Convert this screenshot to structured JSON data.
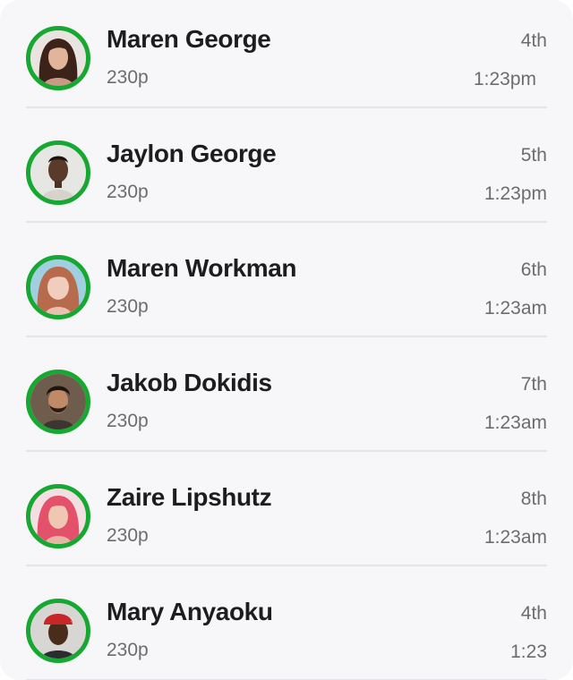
{
  "leaderboard": {
    "accent_color": "#17a832",
    "entries": [
      {
        "name": "Maren George",
        "points": "230p",
        "rank": "4th",
        "time": "1:23pm"
      },
      {
        "name": "Jaylon George",
        "points": "230p",
        "rank": "5th",
        "time": "1:23pm"
      },
      {
        "name": "Maren Workman",
        "points": "230p",
        "rank": "6th",
        "time": "1:23am"
      },
      {
        "name": "Jakob Dokidis",
        "points": "230p",
        "rank": "7th",
        "time": "1:23am"
      },
      {
        "name": "Zaire Lipshutz",
        "points": "230p",
        "rank": "8th",
        "time": "1:23am"
      },
      {
        "name": "Mary Anyaoku",
        "points": "230p",
        "rank": "4th",
        "time": "1:23"
      }
    ]
  }
}
